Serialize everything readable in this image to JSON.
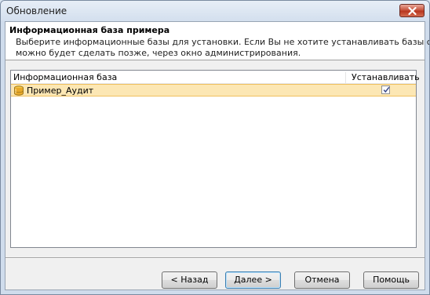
{
  "window": {
    "title": "Обновление"
  },
  "header": {
    "title": "Информационная база примера",
    "description_line1": "Выберите информационные базы для установки. Если Вы не хотите устанавливать базы сейчас, это",
    "description_line2": "можно будет сделать позже, через окно администрирования."
  },
  "list": {
    "columns": [
      "Информационная база",
      "Устанавливать"
    ],
    "rows": [
      {
        "name": "Пример_Аудит",
        "install": true
      }
    ]
  },
  "buttons": {
    "back": "< Назад",
    "next": "Далее >",
    "cancel": "Отмена",
    "help": "Помощь"
  },
  "colors": {
    "selected_row": "#fce7b4",
    "close_button": "#c8553f"
  }
}
